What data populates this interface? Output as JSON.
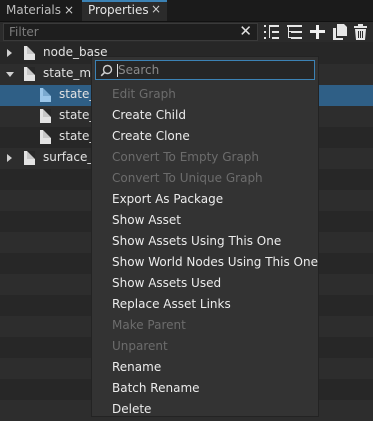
{
  "tabs": [
    {
      "label": "Materials",
      "close": "×"
    },
    {
      "label": "Properties",
      "close": "×"
    }
  ],
  "filter": {
    "placeholder": "Filter",
    "clear": "✕"
  },
  "tree": {
    "items": [
      {
        "label": "node_base",
        "expanded": false
      },
      {
        "label": "state_ma",
        "expanded": true
      },
      {
        "label": "state_",
        "selected": true
      },
      {
        "label": "state_"
      },
      {
        "label": "state_"
      },
      {
        "label": "surface_b",
        "expanded": false
      }
    ]
  },
  "menu": {
    "search_placeholder": "Search",
    "items": [
      {
        "label": "Edit Graph",
        "enabled": false
      },
      {
        "label": "Create Child",
        "enabled": true
      },
      {
        "label": "Create Clone",
        "enabled": true
      },
      {
        "label": "Convert To Empty Graph",
        "enabled": false
      },
      {
        "label": "Convert To Unique Graph",
        "enabled": false
      },
      {
        "label": "Export As Package",
        "enabled": true
      },
      {
        "label": "Show Asset",
        "enabled": true
      },
      {
        "label": "Show Assets Using This One",
        "enabled": true
      },
      {
        "label": "Show World Nodes Using This One",
        "enabled": true
      },
      {
        "label": "Show Assets Used",
        "enabled": true
      },
      {
        "label": "Replace Asset Links",
        "enabled": true
      },
      {
        "label": "Make Parent",
        "enabled": false
      },
      {
        "label": "Unparent",
        "enabled": false
      },
      {
        "label": "Rename",
        "enabled": true
      },
      {
        "label": "Batch Rename",
        "enabled": true
      },
      {
        "label": "Delete",
        "enabled": true
      }
    ]
  },
  "colors": {
    "accent": "#3c82b4",
    "selection": "#2f5f86",
    "background": "#272727"
  }
}
